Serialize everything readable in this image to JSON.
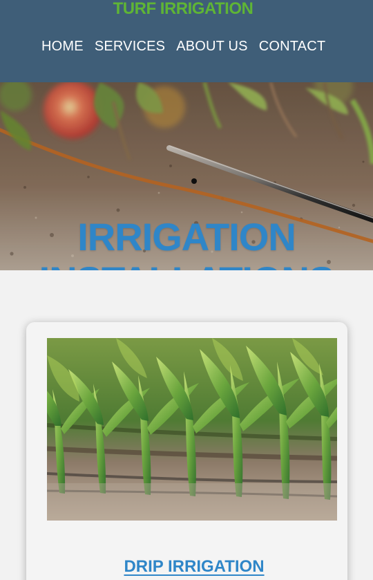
{
  "header": {
    "brand": "TURF IRRIGATION",
    "nav": [
      {
        "label": "HOME"
      },
      {
        "label": "SERVICES"
      },
      {
        "label": "ABOUT US"
      },
      {
        "label": "CONTACT"
      }
    ],
    "colors": {
      "background": "#3f5e78",
      "brand": "#5fb535",
      "nav": "#ffffff"
    }
  },
  "hero": {
    "title": "IRRIGATION INSTALLATIONS",
    "title_color": "#2f86c8",
    "image_icon": "drip-line-soil-photo"
  },
  "services": {
    "cards": [
      {
        "title": "DRIP IRRIGATION",
        "image_icon": "corn-field-drip-photo"
      }
    ]
  }
}
